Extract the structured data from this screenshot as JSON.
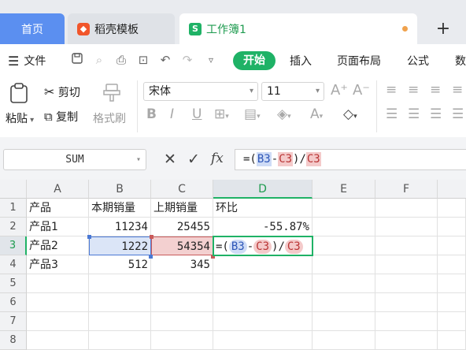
{
  "tabs": {
    "home": "首页",
    "docer": "稻壳模板",
    "workbook": "工作簿1",
    "new_tab": "+"
  },
  "menu": {
    "file": "文件",
    "start": "开始",
    "insert": "插入",
    "page_layout": "页面布局",
    "formula": "公式",
    "data": "数"
  },
  "ribbon": {
    "paste": "粘贴",
    "cut": "剪切",
    "copy": "复制",
    "format_painter": "格式刷",
    "font_name": "宋体",
    "font_size": "11"
  },
  "formula_bar": {
    "name_box": "SUM",
    "fx": "fx",
    "formula": {
      "prefix": "=(",
      "ref1": "B3",
      "op": "-",
      "ref2": "C3",
      "mid": ")/",
      "ref3": "C3"
    }
  },
  "grid": {
    "columns": [
      "A",
      "B",
      "C",
      "D",
      "E",
      "F"
    ],
    "rows": [
      "1",
      "2",
      "3",
      "4",
      "5",
      "6",
      "7",
      "8"
    ],
    "cells": {
      "A1": "产品",
      "B1": "本期销量",
      "C1": "上期销量",
      "D1": "环比",
      "A2": "产品1",
      "B2": "11234",
      "C2": "25455",
      "D2": "-55.87%",
      "A3": "产品2",
      "B3": "1222",
      "C3": "54354",
      "A4": "产品3",
      "B4": "512",
      "C4": "345"
    },
    "edit_cell": {
      "prefix": "=(",
      "ref1": "B3",
      "op": "-",
      "ref2": "C3",
      "mid": ")/",
      "ref3": "C3"
    }
  },
  "colors": {
    "accent_green": "#1fb266",
    "home_tab_blue": "#5b8ff0",
    "ref_blue": "#cfdcf6",
    "ref_red": "#f4caca"
  }
}
